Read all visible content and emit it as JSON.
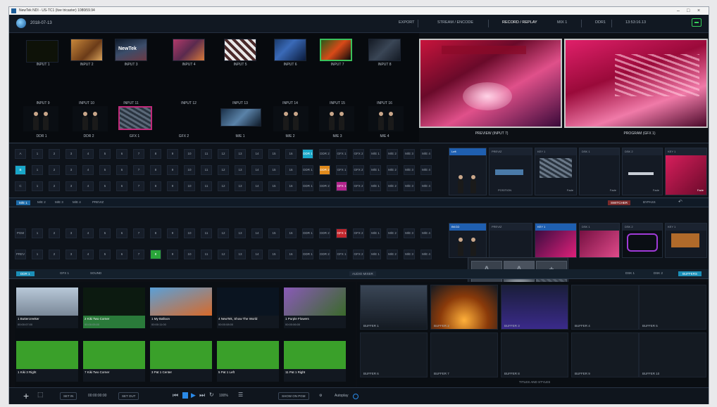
{
  "window": {
    "title": "NewTek NDI - US-TC1 (live tricaster) 1080i59.94"
  },
  "topbar": {
    "date": "2018-07-13",
    "items": [
      "EXPORT",
      "STREAM / ENCODE",
      "RECORD / REPLAY",
      "MIX 1",
      "DDR1",
      "13:53:16.13"
    ]
  },
  "inputs": {
    "row1": [
      "INPUT 1",
      "INPUT 2",
      "INPUT 3",
      "INPUT 4",
      "INPUT 5",
      "INPUT 6",
      "INPUT 7",
      "INPUT 8"
    ],
    "row2": [
      "INPUT 9",
      "INPUT 10",
      "INPUT 11",
      "INPUT 12",
      "INPUT 13",
      "INPUT 14",
      "INPUT 15",
      "INPUT 16"
    ],
    "row3": [
      "DDR 1",
      "DDR 2",
      "GFX 1",
      "GFX 2",
      "M/E 1",
      "M/E 2",
      "M/E 3",
      "M/E 4"
    ]
  },
  "monitors": {
    "preview": "PREVIEW (INPUT 7)",
    "program": "PROGRAM (GFX 1)"
  },
  "mecbar": {
    "tabs": [
      "M/E 1",
      "M/E 2",
      "M/E 3",
      "M/E 4",
      "PREVIZ"
    ],
    "right": [
      "SWITCHER",
      "BYPASS"
    ]
  },
  "switcher": {
    "rows": [
      [
        "A",
        "1",
        "2",
        "3",
        "4",
        "5",
        "6",
        "7",
        "8",
        "9",
        "10",
        "11",
        "12",
        "13",
        "14",
        "15",
        "16",
        "DDR 1",
        "DDR 2",
        "GFX 1",
        "GFX 2",
        "M/E 1",
        "M/E 2",
        "M/E 3",
        "M/E 4"
      ],
      [
        "B",
        "1",
        "2",
        "3",
        "4",
        "5",
        "6",
        "7",
        "8",
        "9",
        "10",
        "11",
        "12",
        "13",
        "14",
        "15",
        "16",
        "DDR 1",
        "DDR 2",
        "GFX 1",
        "GFX 2",
        "M/E 1",
        "M/E 2",
        "M/E 3",
        "M/E 4"
      ],
      [
        "C",
        "1",
        "2",
        "3",
        "4",
        "5",
        "6",
        "7",
        "8",
        "9",
        "10",
        "11",
        "12",
        "13",
        "14",
        "15",
        "16",
        "DDR 1",
        "DDR 2",
        "GFX 1",
        "GFX 2",
        "M/E 1",
        "M/E 2",
        "M/E 3",
        "M/E 4"
      ]
    ],
    "pgm": [
      "PGM",
      "1",
      "2",
      "3",
      "4",
      "5",
      "6",
      "7",
      "8",
      "9",
      "10",
      "11",
      "12",
      "13",
      "14",
      "15",
      "16",
      "DDR 1",
      "DDR 2",
      "GFX 1",
      "GFX 2",
      "M/E 1",
      "M/E 2",
      "M/E 3",
      "M/E 4"
    ],
    "prev": [
      "PREV",
      "1",
      "2",
      "3",
      "4",
      "5",
      "6",
      "7",
      "8",
      "9",
      "10",
      "11",
      "12",
      "13",
      "14",
      "15",
      "16",
      "DDR 1",
      "DDR 2",
      "GFX 1",
      "GFX 2",
      "M/E 1",
      "M/E 2",
      "M/E 3",
      "M/E 4"
    ],
    "slots": [
      "Left",
      "PREVIZ",
      "COMP",
      "KEY 1",
      "DSK 1",
      "DSK 2",
      "KEY 1"
    ],
    "delegates": [
      "Fade",
      "Fade",
      "Fade",
      "Fade"
    ],
    "position": "POSITION",
    "take_label": "Take"
  },
  "popup": {
    "speeds": [
      "SLOW",
      "MEDIUM",
      "FAST",
      "PLAY"
    ]
  },
  "tabs": {
    "left": [
      "DDR 1",
      "GFX 1",
      "SOUND"
    ],
    "mid": "AUDIO MIXER",
    "right": [
      "DSK 1",
      "DSK 2",
      "BUFFERS"
    ]
  },
  "media": [
    {
      "t": "1 Buttercreeker",
      "d": "00:00:07:00"
    },
    {
      "t": "2 Kiki Two Corner",
      "d": "00:00:05:00"
    },
    {
      "t": "1 My Balloon",
      "d": "00:00:11:00"
    },
    {
      "t": "4 NewTek, Show The World",
      "d": "00:00:08:00"
    },
    {
      "t": "1 Purple Flowers",
      "d": "00:00:06:00"
    },
    {
      "t": "1 Kiki 3 Right",
      "d": ""
    },
    {
      "t": "7 Kiki Two Corner",
      "d": ""
    },
    {
      "t": "3 Pat 1 Center",
      "d": ""
    },
    {
      "t": "5 Pat 1 Left",
      "d": ""
    },
    {
      "t": "11 Pat 1 Right",
      "d": ""
    }
  ],
  "buffers": {
    "row1": [
      "BUFFER 1",
      "BUFFER 2",
      "BUFFER 3",
      "BUFFER 4",
      "BUFFER 5"
    ],
    "row2": [
      "BUFFER 6",
      "BUFFER 7",
      "BUFFER 8",
      "BUFFER 9",
      "BUFFER 10"
    ],
    "footer": "TITLES AND STYLES"
  },
  "bottom": {
    "set_in": "SET IN",
    "timecode": "00:00:00:00",
    "set_out": "SET OUT",
    "speed": "100%",
    "show_on_pgm": "SHOW ON PGM",
    "autoplay": "Autoplay"
  }
}
